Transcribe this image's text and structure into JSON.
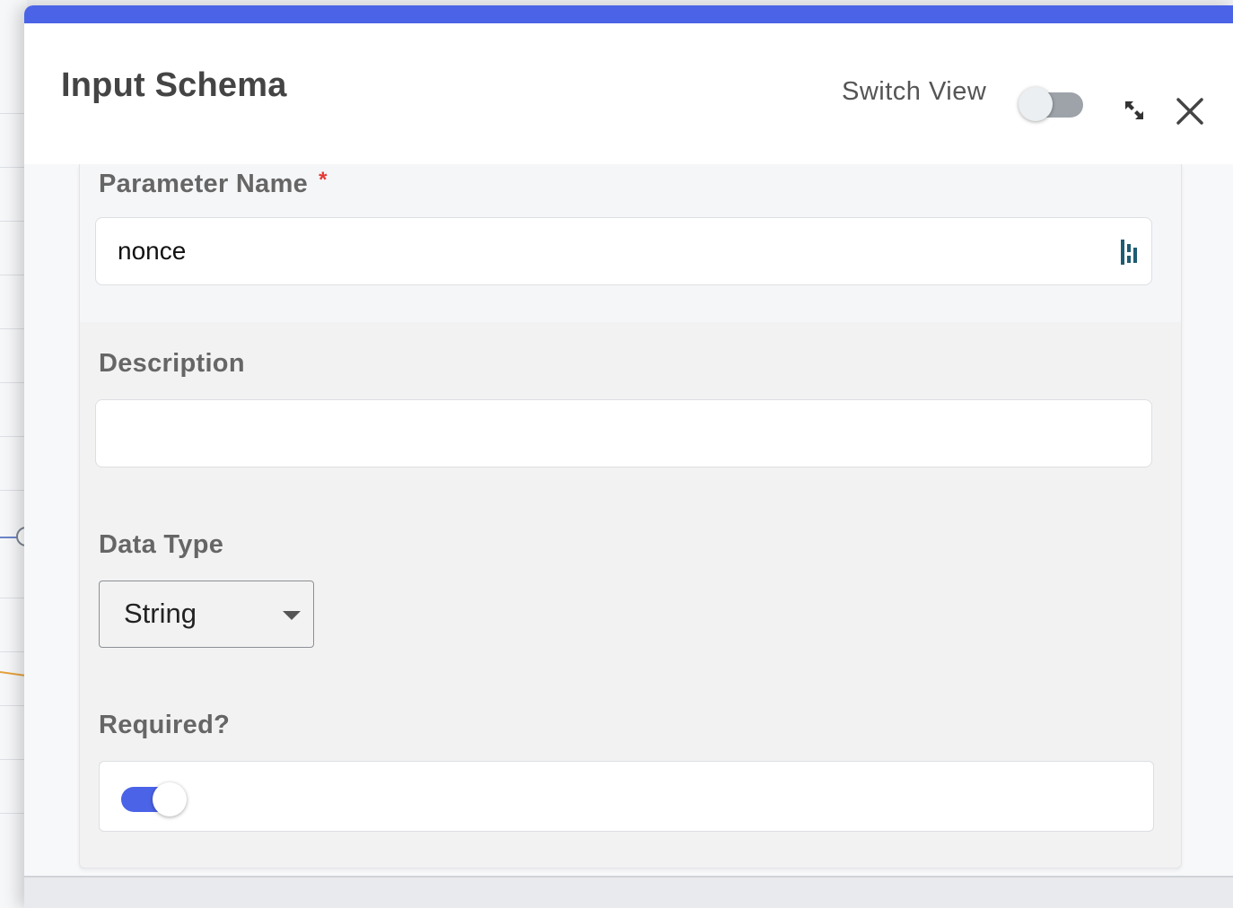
{
  "modal": {
    "title": "Input Schema",
    "switch_view_label": "Switch View",
    "switch_view_on": false,
    "accent_color": "#4a63e7"
  },
  "icons": {
    "collapse": "collapse-arrows-icon",
    "close": "close-icon",
    "variable": "dynamic-value-icon"
  },
  "form": {
    "parameter_name": {
      "label": "Parameter Name",
      "required_marker": "*",
      "value": "nonce"
    },
    "description": {
      "label": "Description",
      "value": ""
    },
    "data_type": {
      "label": "Data Type",
      "selected": "String"
    },
    "required": {
      "label": "Required?",
      "on": true
    }
  }
}
